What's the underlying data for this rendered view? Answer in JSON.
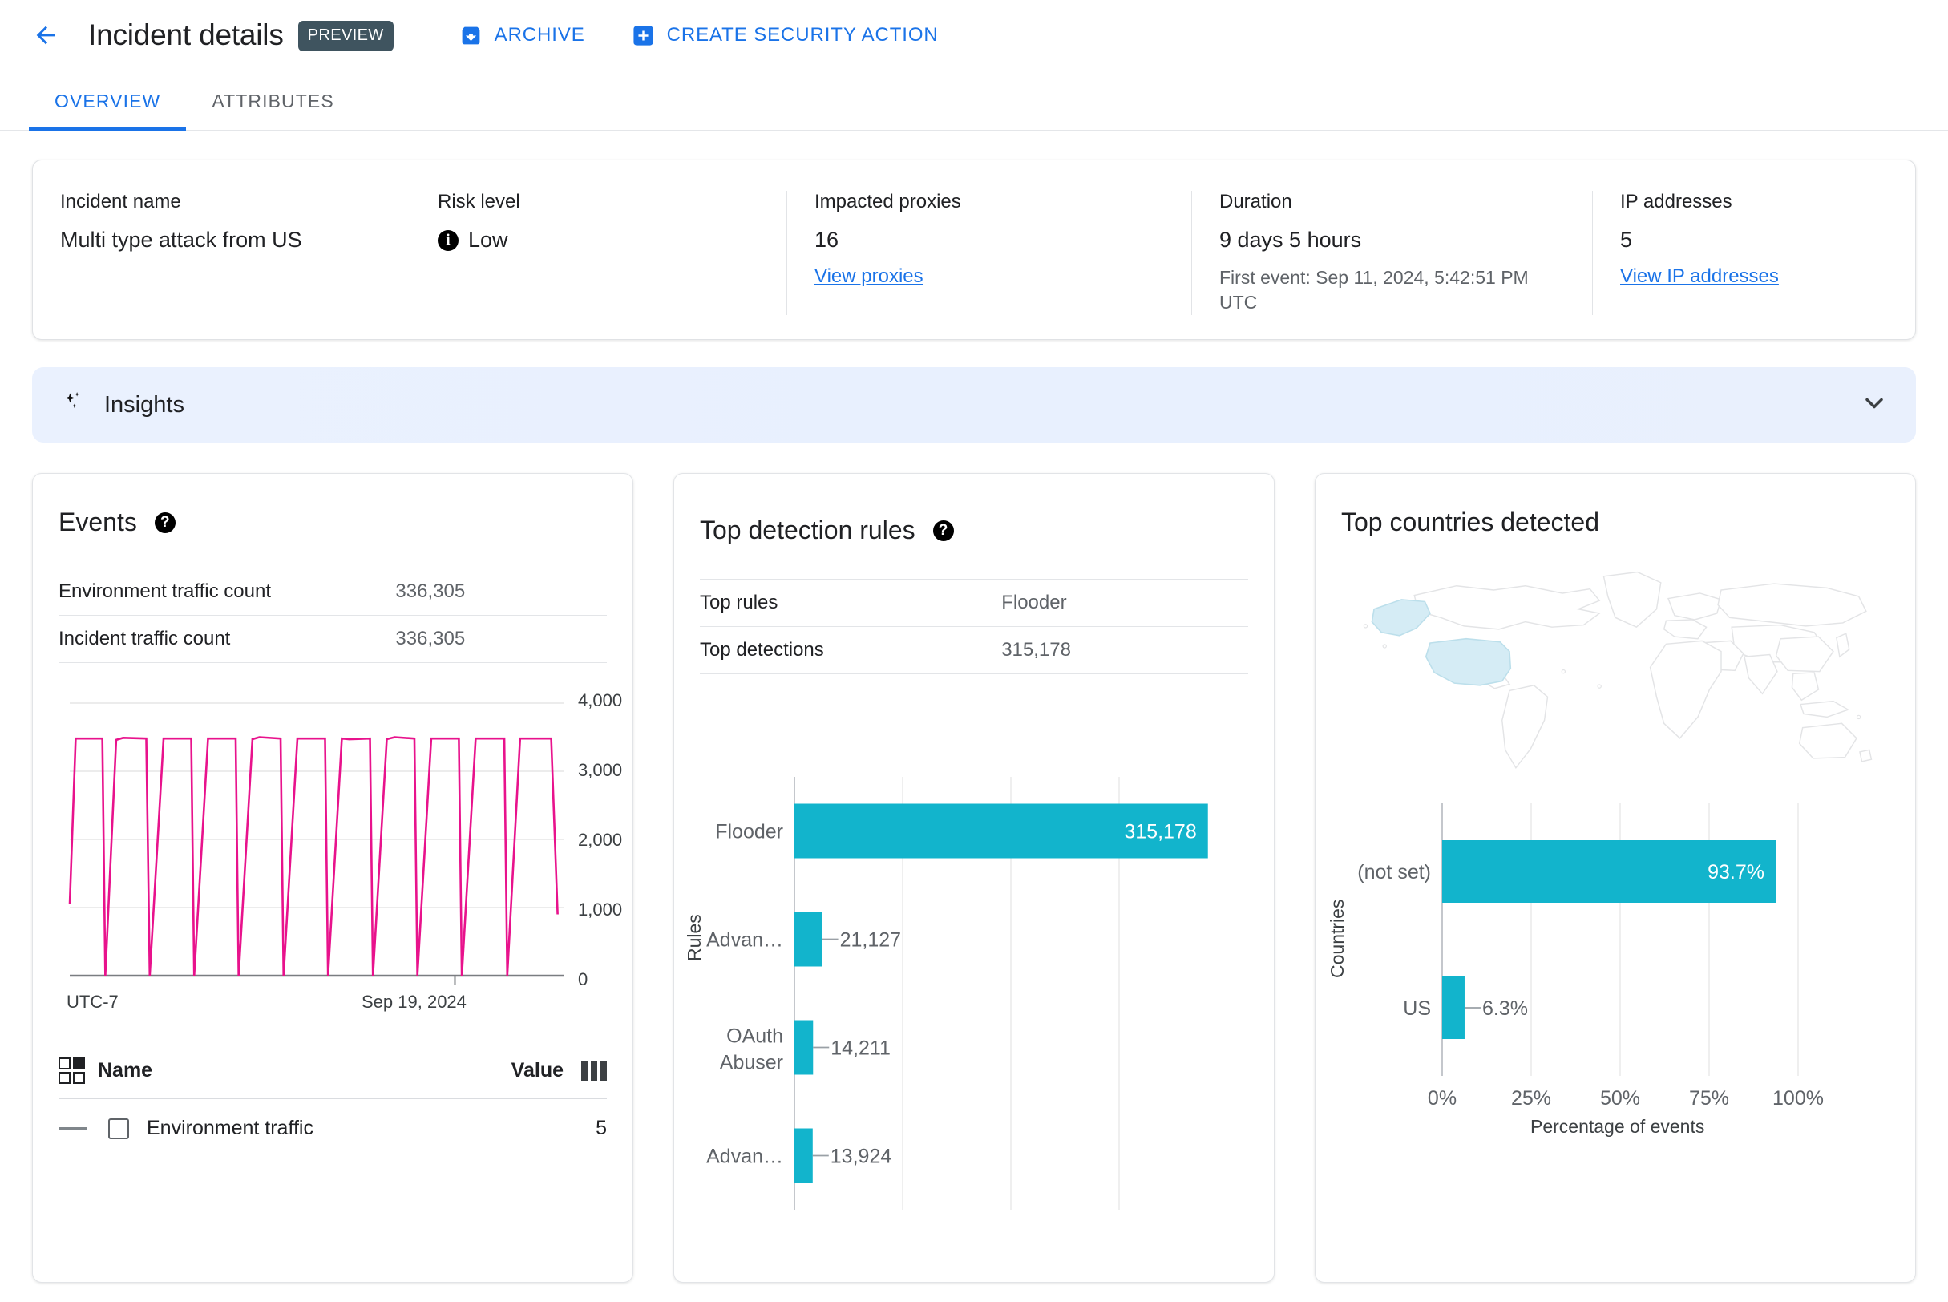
{
  "header": {
    "back_icon": "arrow-left-icon",
    "title": "Incident details",
    "preview_badge": "PREVIEW",
    "actions": [
      {
        "icon": "archive-icon",
        "label": "ARCHIVE"
      },
      {
        "icon": "plus-square-icon",
        "label": "CREATE SECURITY ACTION"
      }
    ]
  },
  "tabs": [
    {
      "label": "OVERVIEW",
      "active": true
    },
    {
      "label": "ATTRIBUTES",
      "active": false
    }
  ],
  "summary": {
    "incident_name_label": "Incident name",
    "incident_name_value": "Multi type attack from US",
    "risk_level_label": "Risk level",
    "risk_level_value": "Low",
    "risk_level_icon": "info-icon",
    "impacted_proxies_label": "Impacted proxies",
    "impacted_proxies_value": "16",
    "impacted_proxies_link": "View proxies",
    "duration_label": "Duration",
    "duration_value": "9 days 5 hours",
    "duration_sub": "First event: Sep 11, 2024, 5:42:51 PM UTC",
    "ip_addresses_label": "IP addresses",
    "ip_addresses_value": "5",
    "ip_addresses_link": "View IP addresses"
  },
  "insights": {
    "icon": "sparkle-icon",
    "title": "Insights",
    "expand_icon": "chevron-down-icon"
  },
  "events_card": {
    "title": "Events",
    "help_icon": "help-icon",
    "rows": [
      {
        "key": "Environment traffic count",
        "value": "336,305"
      },
      {
        "key": "Incident traffic count",
        "value": "336,305"
      }
    ],
    "legend_header": {
      "name": "Name",
      "value": "Value",
      "select_icon": "multi-select-icon",
      "columns_icon": "columns-icon"
    },
    "legend_rows": [
      {
        "name": "Environment traffic",
        "value": "5"
      }
    ]
  },
  "rules_card": {
    "title": "Top detection rules",
    "help_icon": "help-icon",
    "rows": [
      {
        "key": "Top rules",
        "value": "Flooder"
      },
      {
        "key": "Top detections",
        "value": "315,178"
      }
    ]
  },
  "countries_card": {
    "title": "Top countries detected",
    "map_icon": "world-map",
    "highlighted_regions": [
      "United States",
      "Alaska"
    ]
  },
  "chart_data": [
    {
      "id": "events-line",
      "type": "line",
      "title": "",
      "xlabel": "",
      "ylabel": "",
      "ylim": [
        0,
        4000
      ],
      "yticks": [
        0,
        1000,
        2000,
        3000,
        4000
      ],
      "yticklabels": [
        "0",
        "1,000",
        "2,000",
        "3,000",
        "4,000"
      ],
      "xticklabels": [
        "UTC-7",
        "Sep 19, 2024"
      ],
      "grid": true,
      "legend": "none",
      "series_color": "#e8128c",
      "series": [
        {
          "name": "Environment traffic",
          "description": "Sawtooth: 10 plateaus near 3480 separated by 9 vertical drops to 0",
          "plateau_value": 3480,
          "trough_value": 0,
          "cycles": 10,
          "points": [
            [
              0.0,
              1050
            ],
            [
              0.012,
              3480
            ],
            [
              0.066,
              3480
            ],
            [
              0.072,
              0
            ],
            [
              0.094,
              3460
            ],
            [
              0.108,
              3490
            ],
            [
              0.155,
              3480
            ],
            [
              0.162,
              0
            ],
            [
              0.19,
              3480
            ],
            [
              0.246,
              3480
            ],
            [
              0.252,
              0
            ],
            [
              0.28,
              3480
            ],
            [
              0.336,
              3480
            ],
            [
              0.342,
              0
            ],
            [
              0.37,
              3470
            ],
            [
              0.384,
              3500
            ],
            [
              0.427,
              3480
            ],
            [
              0.433,
              0
            ],
            [
              0.461,
              3480
            ],
            [
              0.517,
              3480
            ],
            [
              0.523,
              0
            ],
            [
              0.551,
              3480
            ],
            [
              0.566,
              3470
            ],
            [
              0.608,
              3480
            ],
            [
              0.614,
              0
            ],
            [
              0.642,
              3470
            ],
            [
              0.658,
              3500
            ],
            [
              0.698,
              3480
            ],
            [
              0.704,
              0
            ],
            [
              0.732,
              3480
            ],
            [
              0.788,
              3480
            ],
            [
              0.794,
              0
            ],
            [
              0.822,
              3480
            ],
            [
              0.88,
              3480
            ],
            [
              0.886,
              0
            ],
            [
              0.912,
              3480
            ],
            [
              0.975,
              3480
            ],
            [
              0.988,
              900
            ]
          ]
        }
      ]
    },
    {
      "id": "top-detection-rules-bar",
      "type": "bar",
      "orientation": "horizontal",
      "title": "Top detection rules",
      "xlabel": "",
      "ylabel": "Rules",
      "categories": [
        "Flooder",
        "Advan…",
        "OAuth Abuser",
        "Advan…"
      ],
      "values": [
        315178,
        21127,
        14211,
        13924
      ],
      "value_labels": [
        "315,178",
        "21,127",
        "14,211",
        "13,924"
      ],
      "xlim": [
        0,
        330000
      ],
      "gridlines": 5,
      "bar_color": "#12b4cc",
      "grid": true
    },
    {
      "id": "top-countries-bar",
      "type": "bar",
      "orientation": "horizontal",
      "title": "Top countries detected",
      "xlabel": "Percentage of events",
      "ylabel": "Countries",
      "categories": [
        "(not set)",
        "US"
      ],
      "values": [
        93.7,
        6.3
      ],
      "value_labels": [
        "93.7%",
        "6.3%"
      ],
      "xlim": [
        0,
        100
      ],
      "xticklabels": [
        "0%",
        "25%",
        "50%",
        "75%",
        "100%"
      ],
      "bar_color": "#12b4cc",
      "grid": true
    }
  ]
}
